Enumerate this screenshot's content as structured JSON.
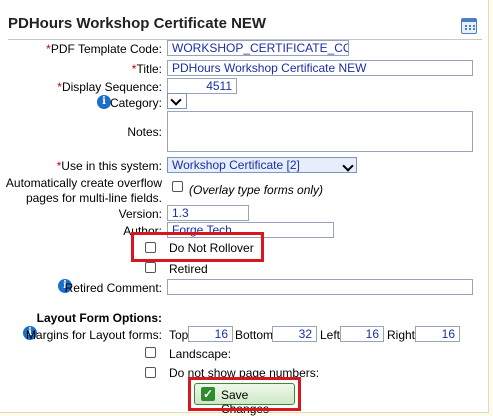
{
  "header": {
    "title": "PDHours Workshop Certificate NEW",
    "calendar_icon": "calendar-icon"
  },
  "form": {
    "pdf_template_code": {
      "label": "PDF Template Code:",
      "value": "WORKSHOP_CERTIFICATE_COPY"
    },
    "title": {
      "label": "Title:",
      "value": "PDHours Workshop Certificate NEW"
    },
    "display_sequence": {
      "label": "Display Sequence:",
      "value": "4511"
    },
    "category": {
      "label": "Category:",
      "value": ""
    },
    "notes": {
      "label": "Notes:",
      "value": ""
    },
    "use_in_system": {
      "label": "Use in this system:",
      "value": "Workshop Certificate [2]"
    },
    "overflow": {
      "label_line1": "Automatically create overflow",
      "label_line2": "pages for multi-line fields.",
      "hint": "(Overlay type forms only)"
    },
    "version": {
      "label": "Version:",
      "value": "1.3"
    },
    "author": {
      "label": "Author:",
      "value": "Forge Tech"
    },
    "do_not_rollover": {
      "label": "Do Not Rollover"
    },
    "retired": {
      "label": "Retired"
    },
    "retired_comment": {
      "label": "Retired Comment:",
      "value": ""
    },
    "layout_options": {
      "label": "Layout Form Options:"
    },
    "margins": {
      "label": "Margins for Layout forms:",
      "top_label": "Top:",
      "top": "16",
      "bottom_label": "Bottom:",
      "bottom": "32",
      "left_label": "Left:",
      "left": "16",
      "right_label": "Right:",
      "right": "16"
    },
    "landscape": {
      "label": "Landscape:"
    },
    "no_page_numbers": {
      "label": "Do not show page numbers:"
    },
    "required_marker": "*"
  },
  "save_button": {
    "label": "Save Changes"
  },
  "colors": {
    "highlight": "#d8161e",
    "required": "#c00000",
    "value_text": "#1a2ea8",
    "info_icon": "#1a6fc9"
  }
}
